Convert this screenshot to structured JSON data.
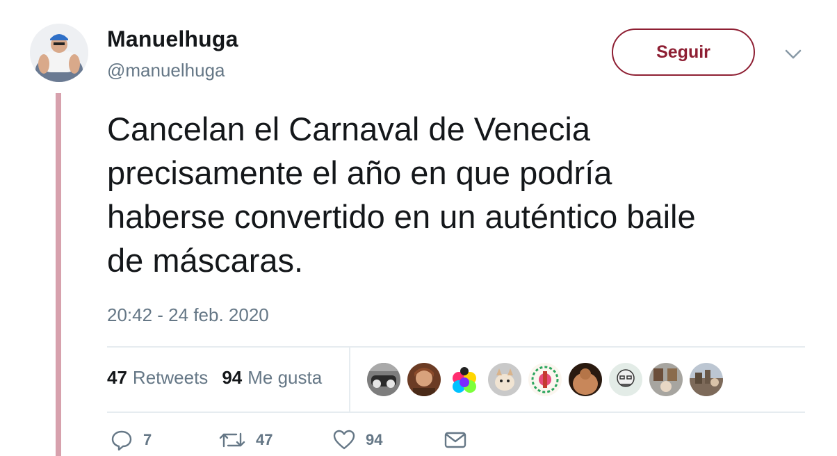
{
  "user": {
    "display_name": "Manuelhuga",
    "handle": "@manuelhuga"
  },
  "follow_button": {
    "label": "Seguir"
  },
  "tweet": {
    "text": "Cancelan el Carnaval de Venecia\nprecisamente el año en que podría\nhaberse convertido en un auténtico baile\nde máscaras.",
    "timestamp": "20:42 - 24 feb. 2020"
  },
  "stats": {
    "retweets_count": "47",
    "retweets_label": "Retweets",
    "likes_count": "94",
    "likes_label": "Me gusta"
  },
  "actions": {
    "reply_count": "7",
    "retweet_count": "47",
    "like_count": "94"
  },
  "colors": {
    "accent": "#8e1f33",
    "thread_line": "#d7a1ad",
    "secondary_text": "#657786",
    "divider": "#e6ecf0"
  },
  "icons": [
    "reply-icon",
    "retweet-icon",
    "heart-icon",
    "mail-icon",
    "chevron-down-icon"
  ]
}
